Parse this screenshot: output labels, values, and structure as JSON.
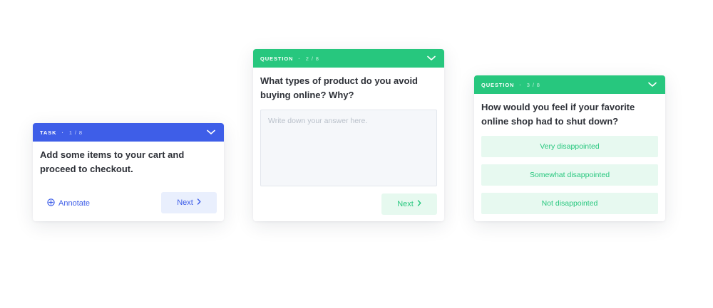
{
  "task_card": {
    "header_label": "TASK",
    "separator": "·",
    "progress": "1 / 8",
    "text": "Add some items to your cart and proceed to checkout.",
    "annotate_label": "Annotate",
    "next_label": "Next",
    "accent": "#3e5ee8"
  },
  "question_card_2": {
    "header_label": "QUESTION",
    "separator": "·",
    "progress": "2 / 8",
    "text": "What types of product do you avoid buying online? Why?",
    "answer_placeholder": "Write down your answer here.",
    "next_label": "Next",
    "accent": "#27c77e"
  },
  "question_card_3": {
    "header_label": "QUESTION",
    "separator": "·",
    "progress": "3 / 8",
    "text": "How would you feel if your favorite online shop had to shut down?",
    "options": [
      "Very disappointed",
      "Somewhat disappointed",
      "Not disappointed"
    ],
    "accent": "#27c77e"
  },
  "icons": {
    "collapse": "chevron-down-icon",
    "annotate": "crosshair-icon",
    "next": "chevron-right-icon"
  }
}
